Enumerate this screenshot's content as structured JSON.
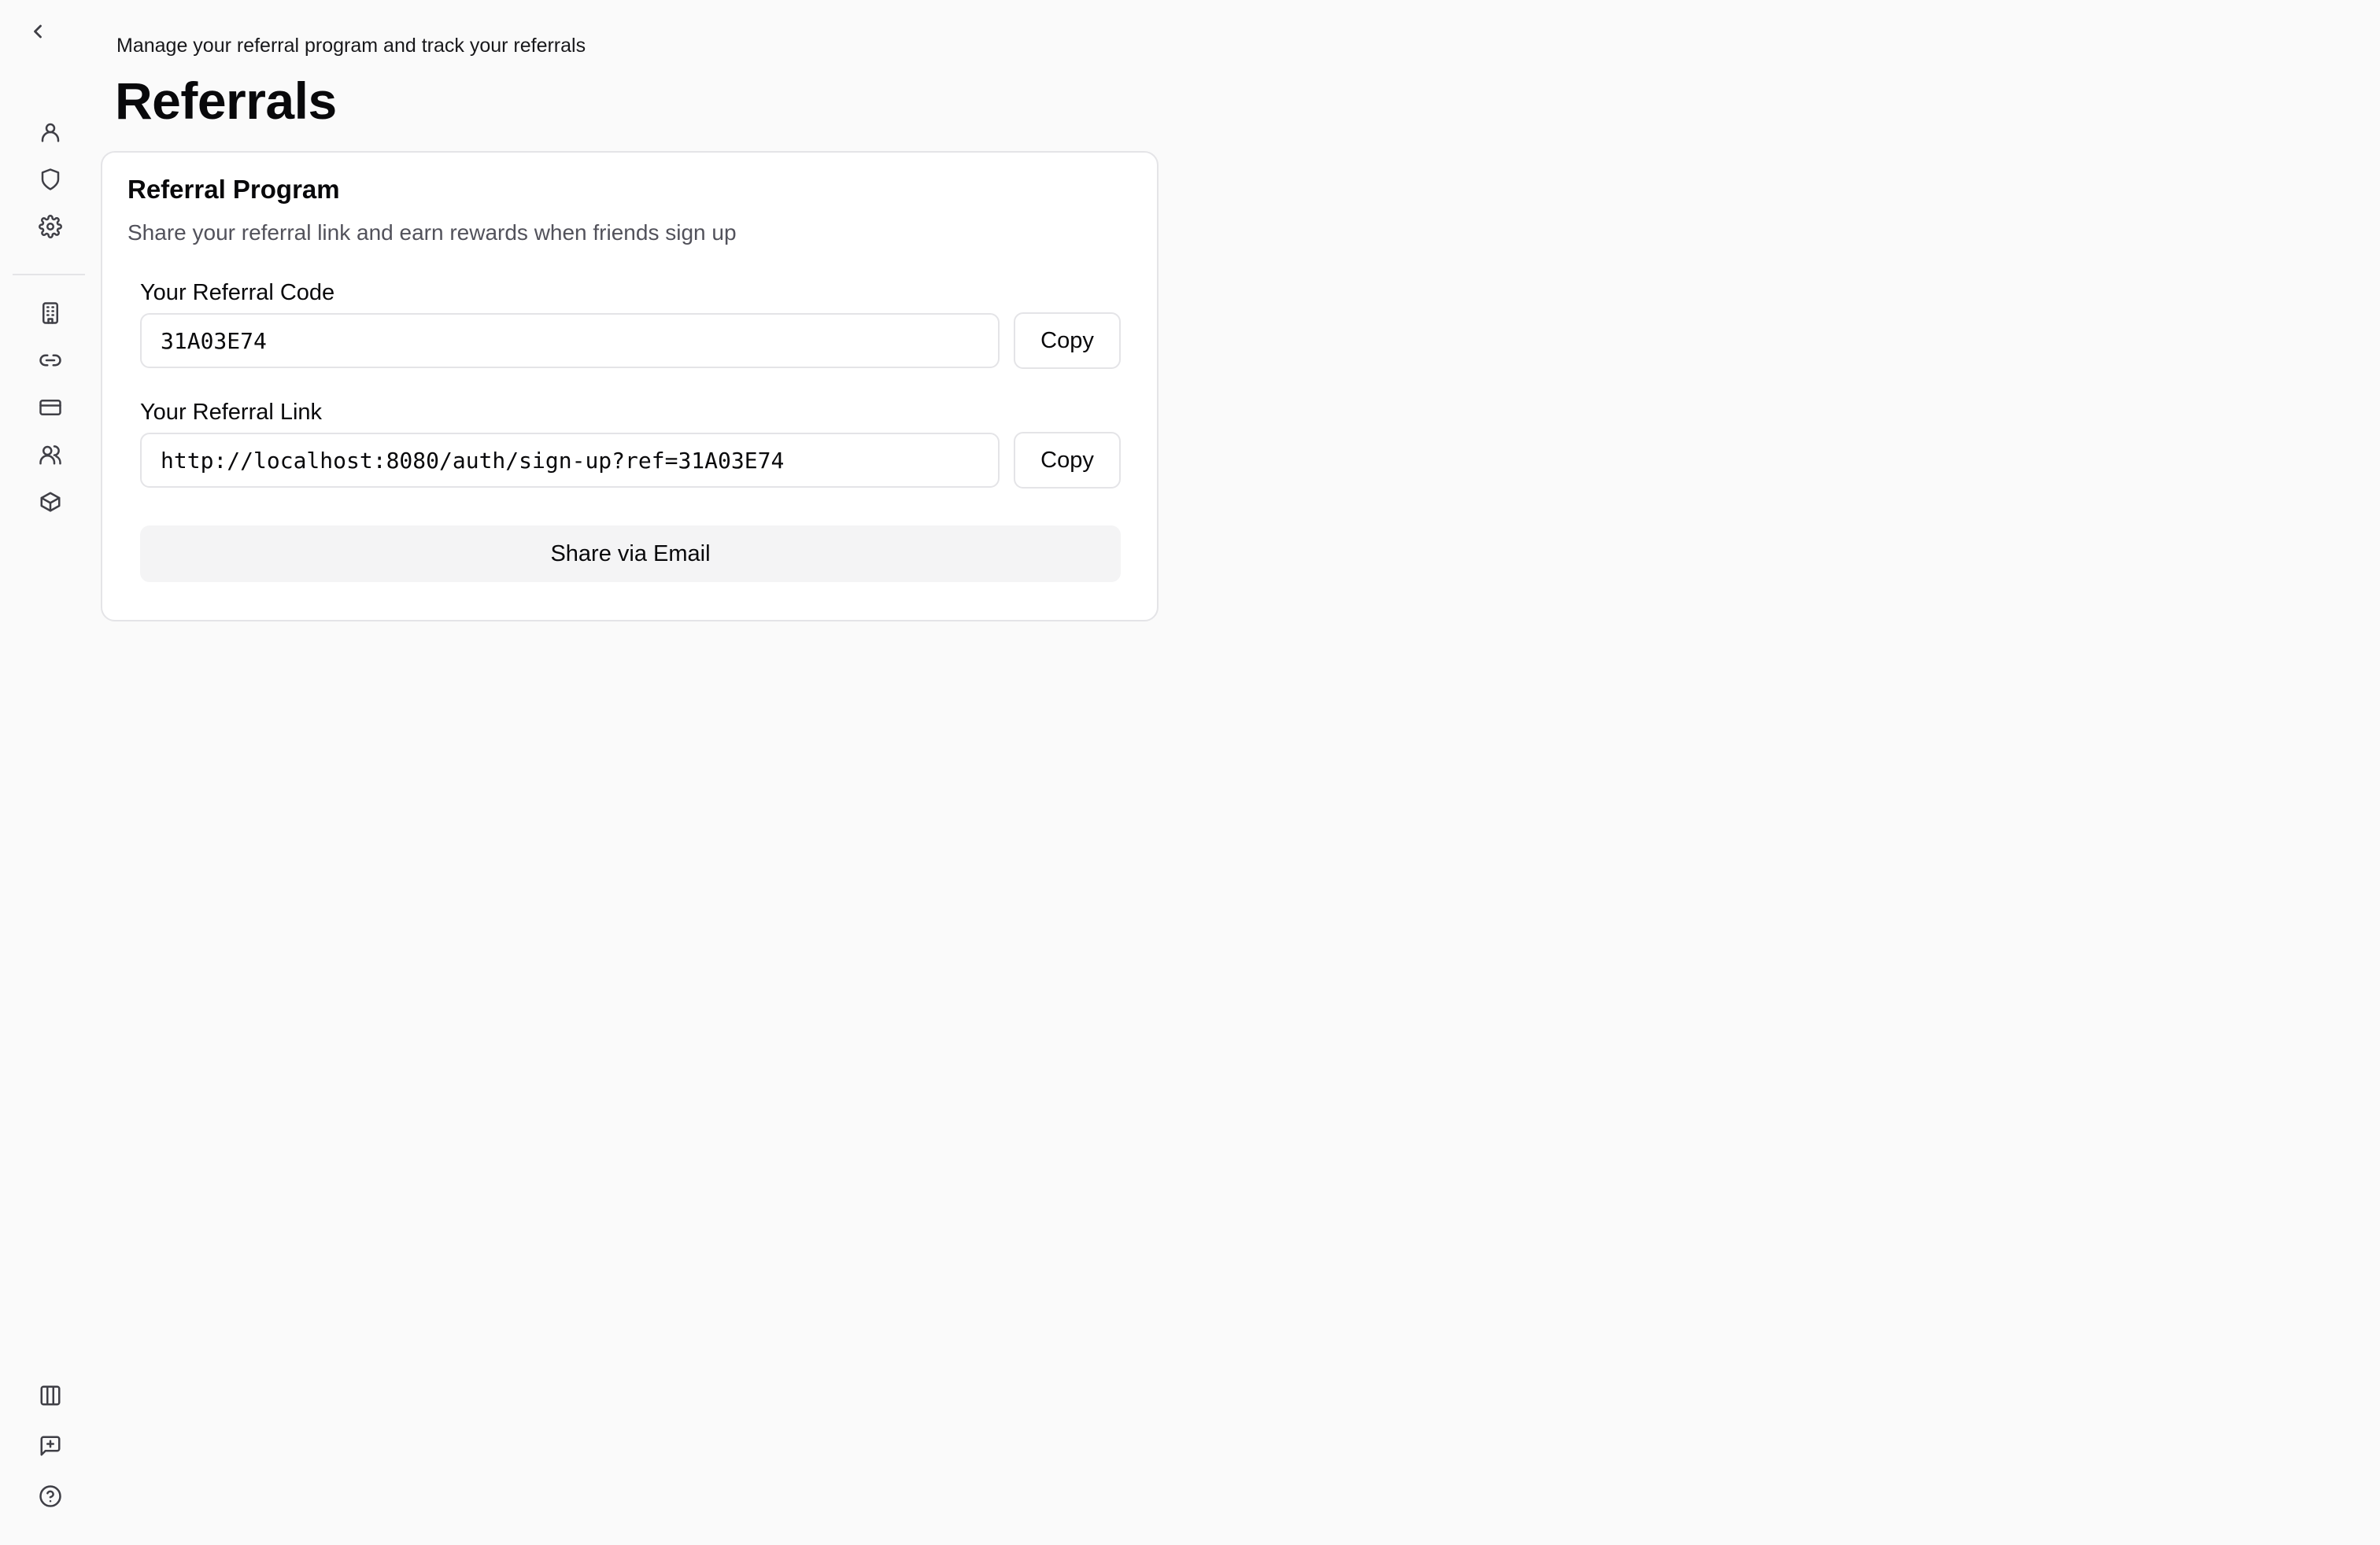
{
  "sidebar": {
    "back_icon": "chevron-left-icon",
    "top_items": [
      {
        "name": "profile",
        "icon": "user-icon"
      },
      {
        "name": "security",
        "icon": "shield-icon"
      },
      {
        "name": "settings",
        "icon": "gear-icon"
      }
    ],
    "middle_items": [
      {
        "name": "organization",
        "icon": "building-icon"
      },
      {
        "name": "referrals",
        "icon": "link-icon"
      },
      {
        "name": "billing",
        "icon": "credit-card-icon"
      },
      {
        "name": "team",
        "icon": "users-icon"
      },
      {
        "name": "integrations",
        "icon": "package-icon"
      }
    ],
    "bottom_items": [
      {
        "name": "layout",
        "icon": "columns-icon"
      },
      {
        "name": "feedback",
        "icon": "message-plus-icon"
      },
      {
        "name": "help",
        "icon": "help-circle-icon"
      }
    ]
  },
  "header": {
    "subtitle": "Manage your referral program and track your referrals",
    "title": "Referrals"
  },
  "card": {
    "title": "Referral Program",
    "description": "Share your referral link and earn rewards when friends sign up",
    "code_label": "Your Referral Code",
    "code_value": "31A03E74",
    "link_label": "Your Referral Link",
    "link_value": "http://localhost:8080/auth/sign-up?ref=31A03E74",
    "copy_label": "Copy",
    "share_label": "Share via Email"
  },
  "colors": {
    "background": "#fafafa",
    "card_background": "#ffffff",
    "border": "#e4e4e7",
    "muted_text": "#52525b",
    "secondary_button": "#f4f4f5"
  }
}
